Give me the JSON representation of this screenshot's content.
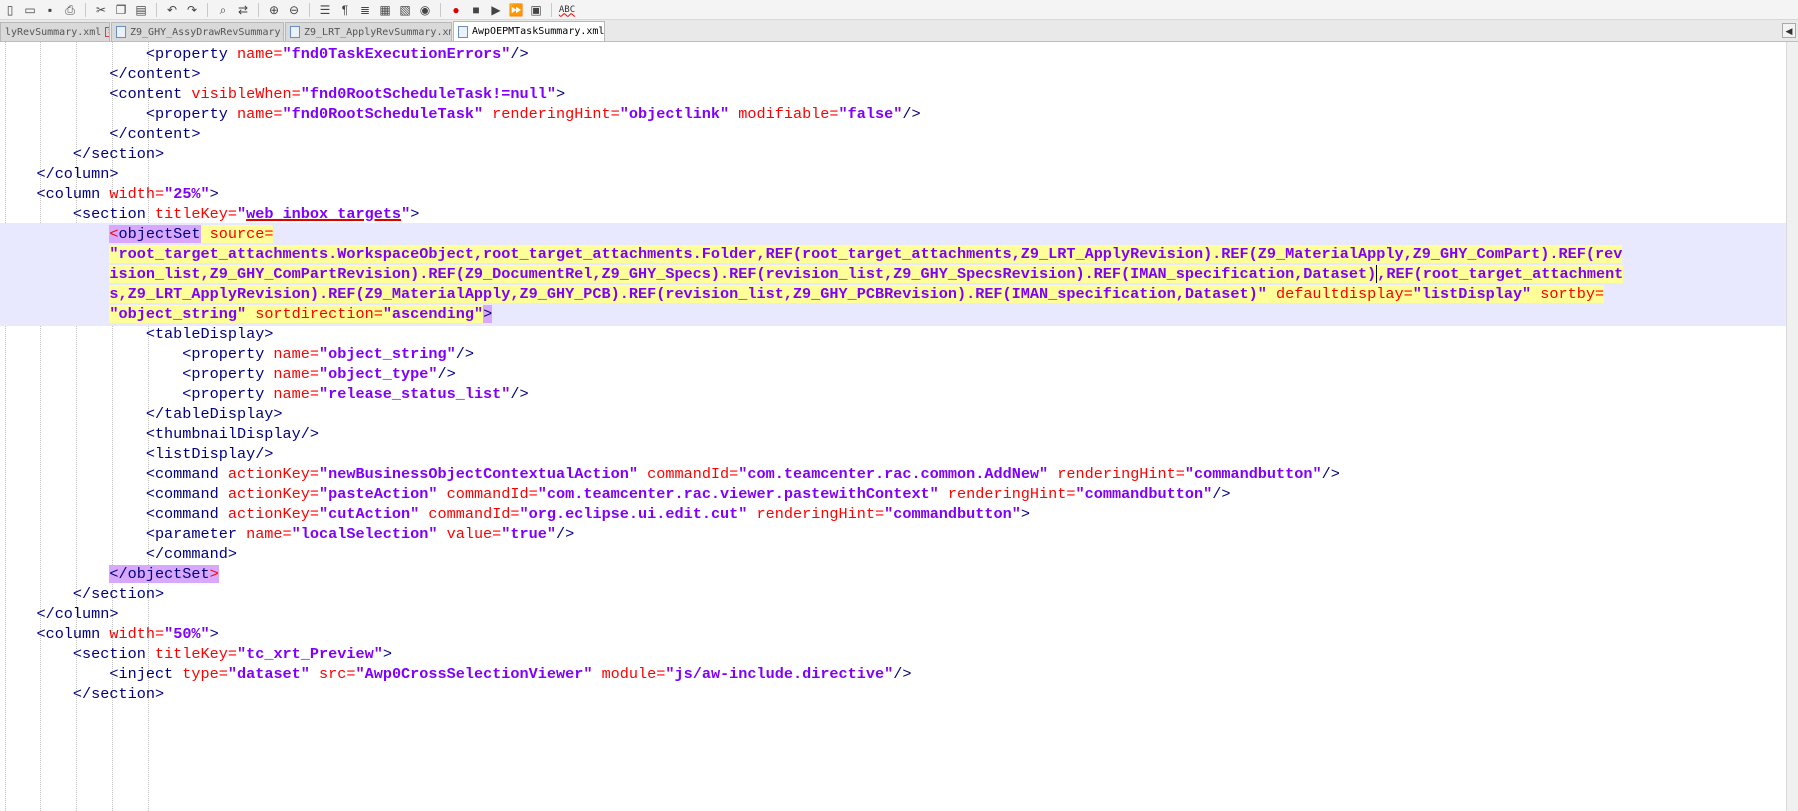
{
  "toolbar": {
    "icons": [
      "new-file-icon",
      "open-icon",
      "save-icon",
      "print-icon",
      "cut-icon",
      "copy-icon",
      "paste-icon",
      "undo-icon",
      "redo-icon",
      "find-icon",
      "replace-icon",
      "zoom-in-icon",
      "zoom-out-icon",
      "sync-icon",
      "wrap-icon",
      "indent-guide-icon",
      "folder-icon",
      "bookmark-icon",
      "monitor-icon",
      "record-icon",
      "stop-icon",
      "play-icon",
      "playback-multiple-icon",
      "save-macro-icon",
      "spellcheck-icon"
    ],
    "spellcheck_label": "ABC"
  },
  "tabs": [
    {
      "label": "lyRevSummary.xml",
      "active": false
    },
    {
      "label": "Z9_GHY_AssyDrawRevSummary.xml",
      "active": false
    },
    {
      "label": "Z9_LRT_ApplyRevSummary.xml",
      "active": false
    },
    {
      "label": "AwpOEPMTaskSummary.xml",
      "active": true
    }
  ],
  "tab_scroll_label": "◀",
  "colors": {
    "tag": "#000080",
    "attribute": "#ff0000",
    "value": "#8000ff",
    "selection": "#e8e8ff",
    "highlight": "#ffff99"
  },
  "code": {
    "l1": {
      "tag": "<property",
      "attr": " name=",
      "val": "\"fnd0TaskExecutionErrors\"",
      "end": "/>"
    },
    "l2": {
      "tag": "</content>"
    },
    "l3": {
      "tag": "<content",
      "attr": " visibleWhen=",
      "val": "\"fnd0RootScheduleTask!=null\"",
      "end": ">"
    },
    "l4": {
      "tag": "<property",
      "a1": " name=",
      "v1": "\"fnd0RootScheduleTask\"",
      "a2": " renderingHint=",
      "v2": "\"objectlink\"",
      "a3": " modifiable=",
      "v3": "\"false\"",
      "end": "/>"
    },
    "l5": {
      "tag": "</content>"
    },
    "l6": {
      "tag": "</section>"
    },
    "l7": {
      "tag": "</column>"
    },
    "l8": {
      "tag": "<column",
      "attr": " width=",
      "val": "\"25%\"",
      "end": ">"
    },
    "l9": {
      "tag": "<section",
      "attr": " titleKey=",
      "q1": "\"",
      "val": "web_inbox_targets",
      "q2": "\"",
      "end": ">"
    },
    "l10": {
      "lt": "<",
      "tag": "objectSet",
      "attr": " source="
    },
    "l11": {
      "v1": "\"root_target_attachments.WorkspaceObject,root_target_attachments.Folder,",
      "v2": "REF(root_target_attachments,Z9_LRT_ApplyRevision).REF(Z9_MaterialApply,Z9_GHY_ComPart).REF(rev"
    },
    "l12": {
      "v1": "ision_list,Z9_GHY_ComPartRevision).REF(Z9_DocumentRel,Z9_GHY_Specs).REF(revision_list,Z9_GHY_SpecsRevision).REF(IMAN_specification,Dataset)",
      "v2": ",REF(root_target_attachment"
    },
    "l13": {
      "v": "s,Z9_LRT_ApplyRevision).REF(Z9_MaterialApply,Z9_GHY_PCB).REF(revision_list,Z9_GHY_PCBRevision).REF(IMAN_specification,Dataset)\"",
      "a1": " defaultdisplay=",
      "v1": "\"listDisplay\"",
      "a2": " sortby="
    },
    "l14": {
      "v1": "\"object_string\"",
      "a1": " sortdirection=",
      "v2": "\"ascending\"",
      "end": ">"
    },
    "l15": {
      "tag": "<tableDisplay>"
    },
    "l16": {
      "tag": "<property",
      "attr": " name=",
      "val": "\"object_string\"",
      "end": "/>"
    },
    "l17": {
      "tag": "<property",
      "attr": " name=",
      "val": "\"object_type\"",
      "end": "/>"
    },
    "l18": {
      "tag": "<property",
      "attr": " name=",
      "val": "\"release_status_list\"",
      "end": "/>"
    },
    "l19": {
      "tag": "</tableDisplay>"
    },
    "l20": {
      "tag": "<thumbnailDisplay/>"
    },
    "l21": {
      "tag": "<listDisplay/>"
    },
    "l22": {
      "tag": "<command",
      "a1": " actionKey=",
      "v1": "\"newBusinessObjectContextualAction\"",
      "a2": " commandId=",
      "v2": "\"com.teamcenter.rac.common.AddNew\"",
      "a3": " renderingHint=",
      "v3": "\"commandbutton\"",
      "end": "/>"
    },
    "l23": {
      "tag": "<command",
      "a1": " actionKey=",
      "v1": "\"pasteAction\"",
      "a2": " commandId=",
      "v2": "\"com.teamcenter.rac.viewer.pastewithContext\"",
      "a3": " renderingHint=",
      "v3": "\"commandbutton\"",
      "end": "/>"
    },
    "l24": {
      "tag": "<command",
      "a1": " actionKey=",
      "v1": "\"cutAction\"",
      "a2": " commandId=",
      "v2": "\"org.eclipse.ui.edit.cut\"",
      "a3": " renderingHint=",
      "v3": "\"commandbutton\"",
      "end": ">"
    },
    "l25": {
      "tag": "<parameter",
      "a1": " name=",
      "v1": "\"localSelection\"",
      "a2": " value=",
      "v2": "\"true\"",
      "end": "/>"
    },
    "l26": {
      "tag": "</command>"
    },
    "l27": {
      "open": "</",
      "tag": "objectSet",
      "close": ">"
    },
    "l28": {
      "tag": "</section>"
    },
    "l29": {
      "tag": "</column>"
    },
    "l30": {
      "tag": "<column",
      "attr": " width=",
      "val": "\"50%\"",
      "end": ">"
    },
    "l31": {
      "tag": "<section",
      "attr": " titleKey=",
      "val": "\"tc_xrt_Preview\"",
      "end": ">"
    },
    "l32": {
      "tag": "<inject",
      "a1": " type=",
      "v1": "\"dataset\"",
      "a2": " src=",
      "v2": "\"Awp0CrossSelectionViewer\"",
      "a3": " module=",
      "v3": "\"js/aw-include.directive\"",
      "end": "/>"
    },
    "l33": {
      "tag": "</section>"
    }
  }
}
